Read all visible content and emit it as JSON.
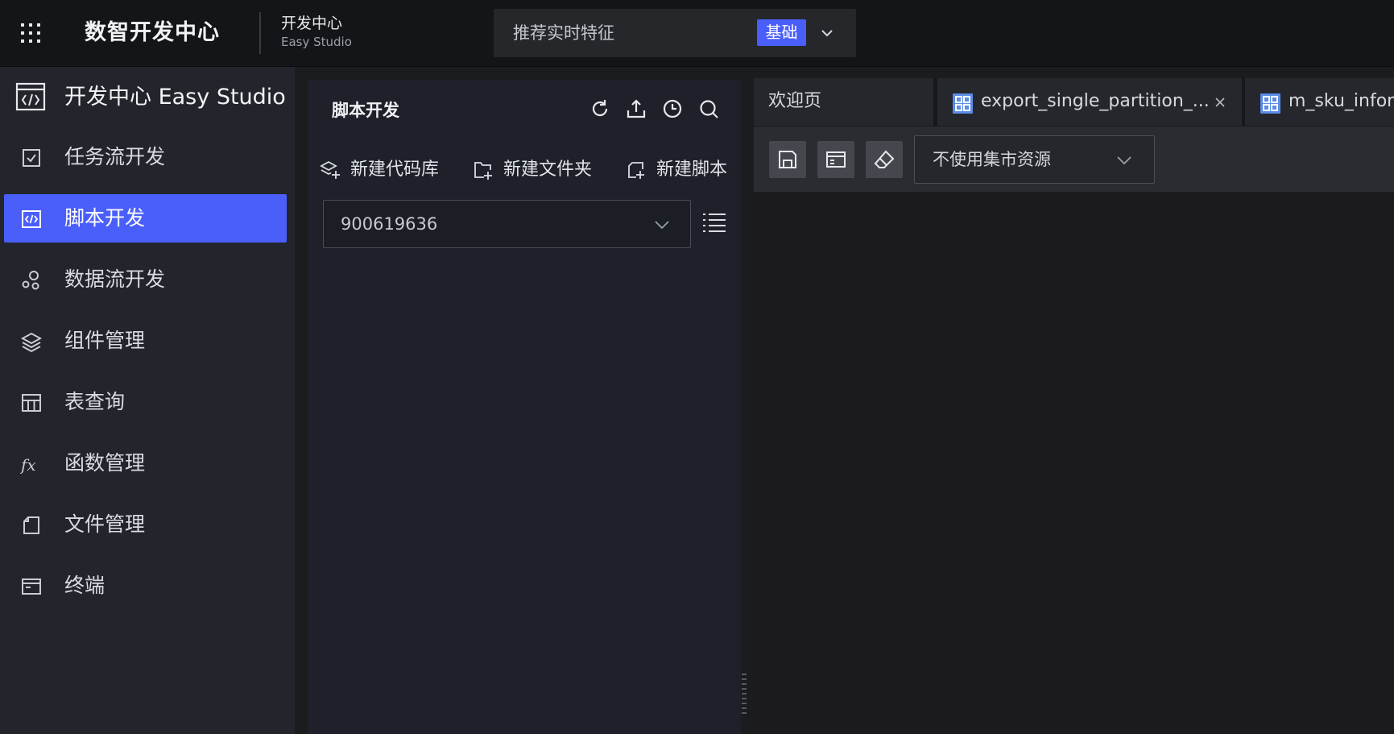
{
  "topbar": {
    "app_title": "数智开发中心",
    "module_title": "开发中心",
    "module_subtitle": "Easy Studio",
    "project": {
      "name": "推荐实时特征",
      "badge": "基础"
    }
  },
  "sidebar": {
    "header": "开发中心 Easy Studio",
    "active_index": 1,
    "items": [
      {
        "label": "任务流开发",
        "icon": "checkbox-icon"
      },
      {
        "label": "脚本开发",
        "icon": "code-icon"
      },
      {
        "label": "数据流开发",
        "icon": "dataflow-icon"
      },
      {
        "label": "组件管理",
        "icon": "layers-icon"
      },
      {
        "label": "表查询",
        "icon": "table-icon"
      },
      {
        "label": "函数管理",
        "icon": "function-icon"
      },
      {
        "label": "文件管理",
        "icon": "file-icon"
      },
      {
        "label": "终端",
        "icon": "terminal-icon"
      }
    ]
  },
  "script_panel": {
    "title": "脚本开发",
    "tools": [
      "refresh-icon",
      "upload-icon",
      "history-icon",
      "search-icon"
    ],
    "actions": {
      "new_repo": "新建代码库",
      "new_folder": "新建文件夹",
      "new_script": "新建脚本"
    },
    "repo_value": "900619636"
  },
  "editor": {
    "tabs": [
      {
        "label": "欢迎页"
      },
      {
        "label": "export_single_partition_...",
        "closable": true
      },
      {
        "label": "m_sku_inform"
      }
    ],
    "toolbar": {
      "buttons": [
        "save-icon",
        "window-icon",
        "eraser-icon"
      ],
      "resource_value": "不使用集市资源"
    }
  },
  "colors": {
    "accent": "#4a5ffa",
    "topbar_bg": "#141518",
    "sidebar_bg": "#22252c",
    "panel_bg": "#1e212a",
    "editor_bg": "#1b1b1d",
    "tab_icon": "#5b8de8"
  }
}
